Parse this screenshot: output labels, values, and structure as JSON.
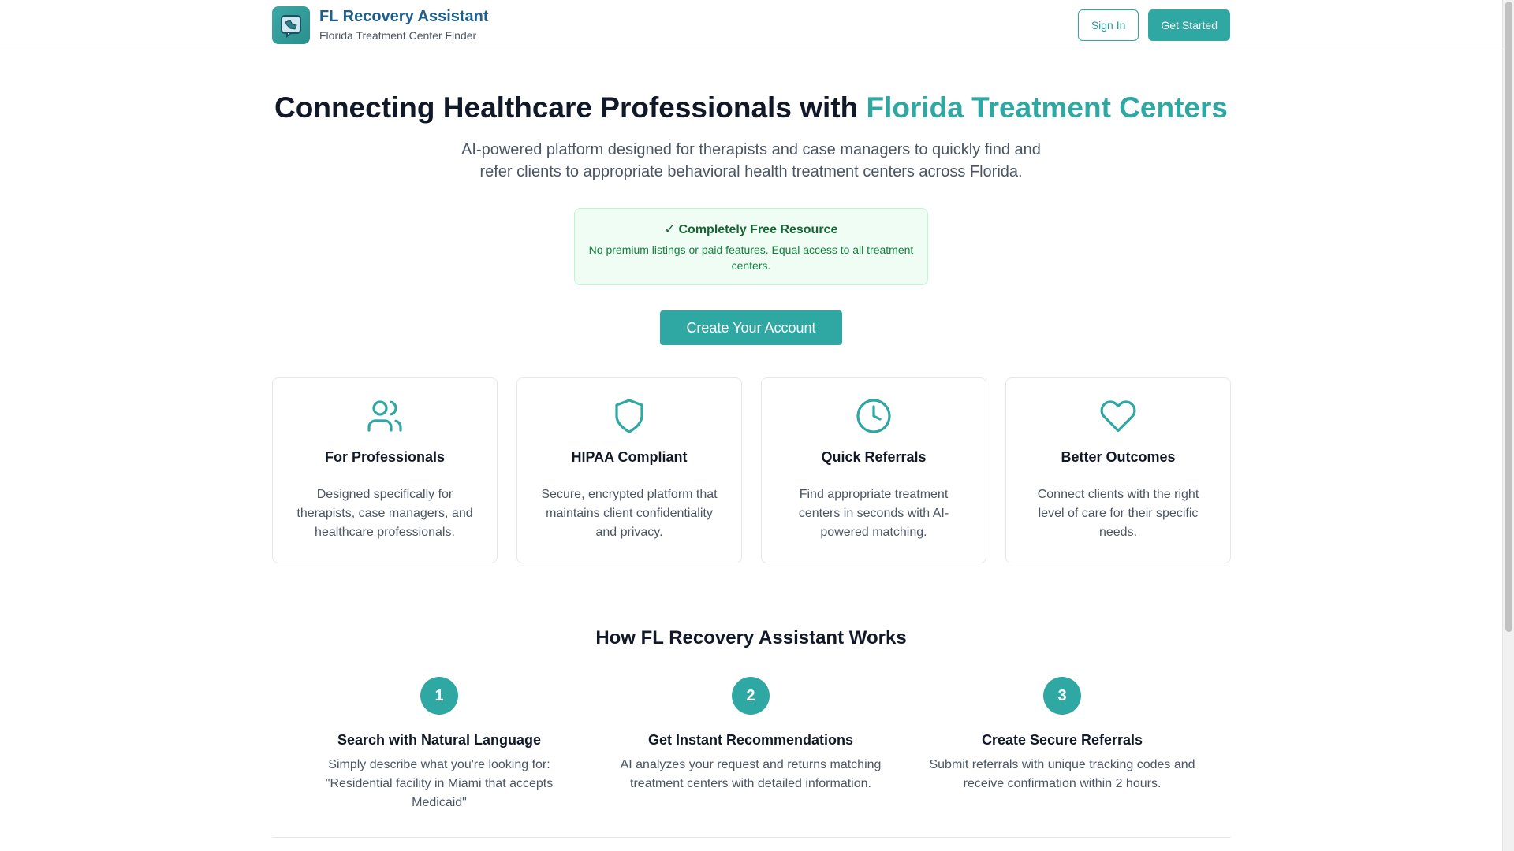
{
  "header": {
    "brand_title": "FL Recovery Assistant",
    "brand_subtitle": "Florida Treatment Center Finder",
    "sign_in": "Sign In",
    "get_started": "Get Started"
  },
  "hero": {
    "title_prefix": "Connecting Healthcare Professionals with",
    "title_accent": "Florida Treatment Centers",
    "description": "AI-powered platform designed for therapists and case managers to quickly find and refer clients to appropriate behavioral health treatment centers across Florida.",
    "free_title": "✓ Completely Free Resource",
    "free_text": "No premium listings or paid features. Equal access to all treatment centers.",
    "cta": "Create Your Account"
  },
  "features": [
    {
      "icon": "users-icon",
      "title": "For Professionals",
      "text": "Designed specifically for therapists, case managers, and healthcare professionals."
    },
    {
      "icon": "shield-icon",
      "title": "HIPAA Compliant",
      "text": "Secure, encrypted platform that maintains client confidentiality and privacy."
    },
    {
      "icon": "clock-icon",
      "title": "Quick Referrals",
      "text": "Find appropriate treatment centers in seconds with AI-powered matching."
    },
    {
      "icon": "heart-icon",
      "title": "Better Outcomes",
      "text": "Connect clients with the right level of care for their specific needs."
    }
  ],
  "how": {
    "title": "How FL Recovery Assistant Works",
    "steps": [
      {
        "num": "1",
        "title": "Search with Natural Language",
        "text": "Simply describe what you're looking for: \"Residential facility in Miami that accepts Medicaid\""
      },
      {
        "num": "2",
        "title": "Get Instant Recommendations",
        "text": "AI analyzes your request and returns matching treatment centers with detailed information."
      },
      {
        "num": "3",
        "title": "Create Secure Referrals",
        "text": "Submit referrals with unique tracking codes and receive confirmation within 2 hours."
      }
    ]
  },
  "colors": {
    "accent": "#2fa7a3",
    "brand": "#1f5f8b",
    "success_bg": "#f0fdf4",
    "success_text": "#166534"
  }
}
